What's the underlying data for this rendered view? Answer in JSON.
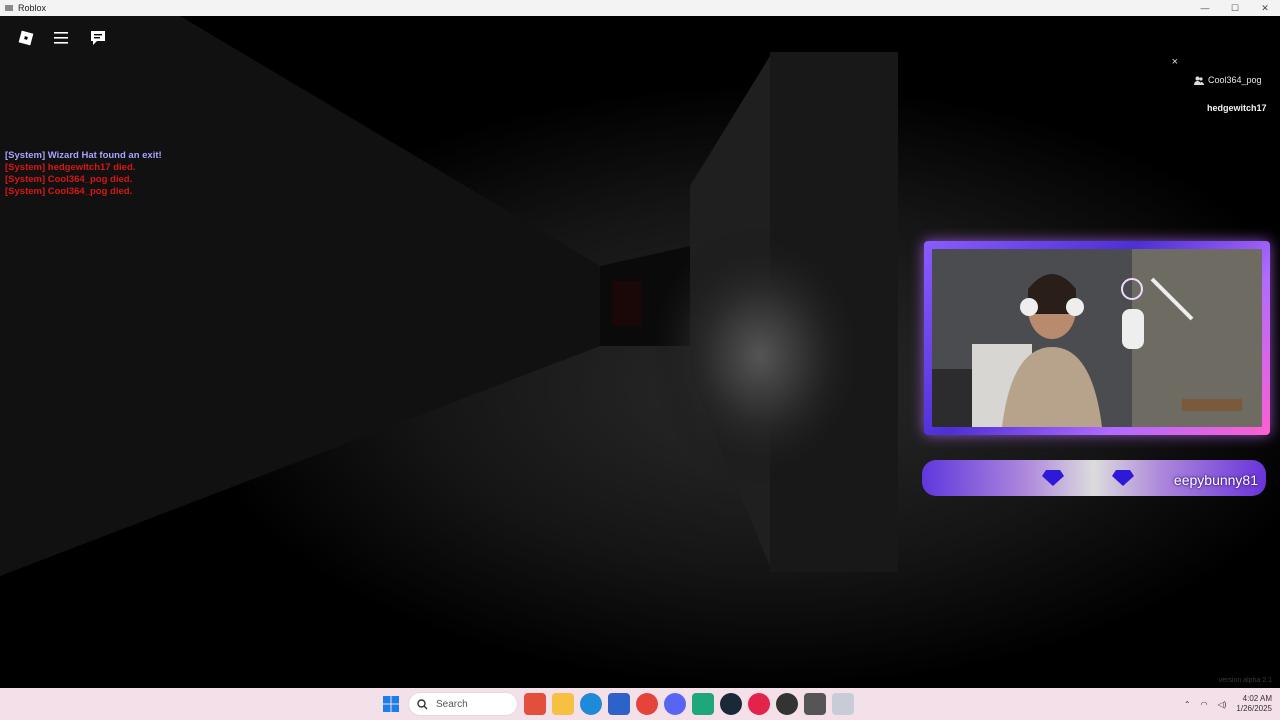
{
  "window": {
    "title": "Roblox",
    "controls": [
      "—",
      "☐",
      "✕"
    ]
  },
  "topbar": {
    "icons": [
      "roblox-logo-icon",
      "menu-icon",
      "chat-icon"
    ]
  },
  "chat": {
    "messages": [
      {
        "text": "[System] Wizard Hat found an exit!",
        "color": "#a7a4ff"
      },
      {
        "text": "[System] hedgewitch17 died.",
        "color": "#d81616"
      },
      {
        "text": "[System] Cool364_pog died.",
        "color": "#d81616"
      },
      {
        "text": "[System] Cool364_pog died.",
        "color": "#d81616"
      }
    ]
  },
  "players": {
    "close": "×",
    "self": "Cool364_pog",
    "other": "hedgewitch17"
  },
  "overlay": {
    "name": "eepybunny81"
  },
  "version": "version alpha 2.1",
  "taskbar": {
    "search_placeholder": "Search",
    "time": "4:02 AM",
    "date": "1/26/2025"
  },
  "colors": {
    "accent_purple": "#8a5cff",
    "chat_system": "#a7a4ff",
    "chat_death": "#d81616",
    "taskbar": "#f4e0e8"
  }
}
